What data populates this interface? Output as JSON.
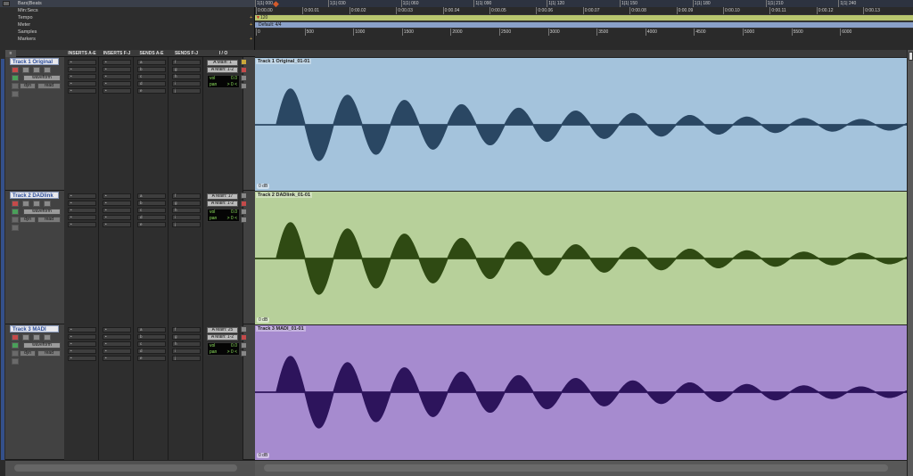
{
  "rulers": {
    "labels": [
      "Bars|Beats",
      "Min:Secs",
      "Tempo",
      "Meter",
      "Samples",
      "Markers"
    ],
    "bars_ticks": [
      "1|1| 000",
      "1|1| 030",
      "1|1| 060",
      "1|1| 090",
      "1|1| 120",
      "1|1| 150",
      "1|1| 180",
      "1|1| 210",
      "1|1| 240"
    ],
    "minsecs_ticks": [
      "0:00.00",
      "0:00.01",
      "0:00.02",
      "0:00.03",
      "0:00.04",
      "0:00.05",
      "0:00.06",
      "0:00.07",
      "0:00.08",
      "0:00.09",
      "0:00.10",
      "0:00.11",
      "0:00.12",
      "0:00.13"
    ],
    "tempo_value": "120",
    "meter_value": "Default: 4/4",
    "samples_ticks": [
      "0",
      "500",
      "1000",
      "1500",
      "2000",
      "2500",
      "3000",
      "3500",
      "4000",
      "4500",
      "5000",
      "5500",
      "6000"
    ]
  },
  "columns": {
    "inserts_ae": "INSERTS A-E",
    "inserts_fj": "INSERTS F-J",
    "sends_ae": "SENDS A-E",
    "sends_fj": "SENDS F-J",
    "io": "I / O"
  },
  "tracks": [
    {
      "name": "Track 1 Original",
      "color": "#a4c3dc",
      "wave_color": "#2a4763",
      "region_name": "Track 1 Original_01-01",
      "gain": "0 dB",
      "io_out": "A Main: 1",
      "io_bus": "A Main: 1-2",
      "vol_label": "vol",
      "vol_value": "0.0",
      "pan_label": "pan",
      "pan_value": "> 0 <",
      "view": "waveform",
      "automation": "read",
      "dyn_label": "dyn",
      "send_letters_ae": [
        "a",
        "b",
        "c",
        "d",
        "e"
      ],
      "send_letters_fj": [
        "f",
        "g",
        "h",
        "i",
        "j"
      ],
      "slot_marks": [
        "•",
        "•",
        "•",
        "•",
        "•"
      ]
    },
    {
      "name": "Track 2 DADlink",
      "color": "#b7d09a",
      "wave_color": "#2f4a13",
      "region_name": "Track 2 DADlink_01-01",
      "gain": "0 dB",
      "io_out": "A Main: 17",
      "io_bus": "A Main: 1-2",
      "vol_label": "vol",
      "vol_value": "0.0",
      "pan_label": "pan",
      "pan_value": "> 0 <",
      "view": "waveform",
      "automation": "read",
      "dyn_label": "dyn",
      "send_letters_ae": [
        "a",
        "b",
        "c",
        "d",
        "e"
      ],
      "send_letters_fj": [
        "f",
        "g",
        "h",
        "i",
        "j"
      ],
      "slot_marks": [
        "•",
        "•",
        "•",
        "•",
        "•"
      ]
    },
    {
      "name": "Track 3 MADI",
      "color": "#a68bcf",
      "wave_color": "#2d145c",
      "region_name": "Track 3 MADI_01-01",
      "gain": "0 dB",
      "io_out": "A Main: 25",
      "io_bus": "A Main: 1-2",
      "vol_label": "vol",
      "vol_value": "0.0",
      "pan_label": "pan",
      "pan_value": "> 0 <",
      "view": "waveform",
      "automation": "read",
      "dyn_label": "dyn",
      "send_letters_ae": [
        "a",
        "b",
        "c",
        "d",
        "e"
      ],
      "send_letters_fj": [
        "f",
        "g",
        "h",
        "i",
        "j"
      ],
      "slot_marks": [
        "•",
        "•",
        "•",
        "•",
        "•"
      ]
    }
  ],
  "icons": {
    "playhead": "playhead-icon",
    "record": "record-enable-icon",
    "solo": "solo-icon",
    "mute": "mute-icon",
    "input": "input-monitor-icon"
  },
  "colors": {
    "background": "#3a3a3a",
    "track_name_text": "#2a4c9a",
    "meter_green": "#8fe35e",
    "record_red": "#c44a4a",
    "ruler_tempo_bar": "#b9c66e",
    "ruler_meter_bar": "#8aa0c8",
    "playhead": "#d45a2a"
  }
}
